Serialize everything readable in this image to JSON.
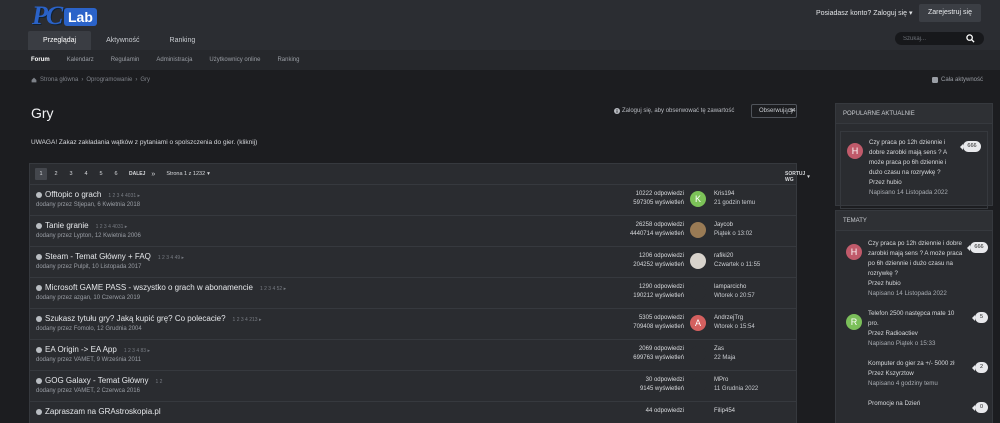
{
  "logo": {
    "pc": "PC",
    "lab": "Lab"
  },
  "header": {
    "account_link": "Posiadasz konto? Zaloguj się",
    "register_label": "Zarejestruj się",
    "tabs": [
      {
        "label": "Przeglądaj",
        "active": true
      },
      {
        "label": "Aktywność",
        "active": false
      },
      {
        "label": "Ranking",
        "active": false
      }
    ],
    "search_placeholder": "Szukaj..."
  },
  "subnav": [
    {
      "label": "Forum",
      "active": true
    },
    {
      "label": "Kalendarz"
    },
    {
      "label": "Regulamin"
    },
    {
      "label": "Administracja"
    },
    {
      "label": "Użytkownicy online"
    },
    {
      "label": "Ranking"
    }
  ],
  "breadcrumb": [
    "Strona główna",
    "Oprogramowanie",
    "Gry"
  ],
  "all_activity": "Cała aktywność",
  "page_title": "Gry",
  "login_follow": "Zaloguj się, aby obserwować tę zawartość",
  "follow": {
    "label": "Obserwujący",
    "count": "94"
  },
  "notice": "UWAGA! Zakaz zakładania wątków z pytaniami o spolszczenia do gier. (kliknij)",
  "pager": {
    "pages": [
      "1",
      "2",
      "3",
      "4",
      "5",
      "6"
    ],
    "next_label": "DALEJ",
    "last_glyph": "»",
    "page_of": "Strona 1 z 1232",
    "sort_label": "SORTUJ WG"
  },
  "topics": [
    {
      "title": "Offtopic o grach",
      "mini_pages": "1 2 3 4 4031 ▸",
      "byline": "dodany przez Stjepan, 6 Kwietnia 2018",
      "replies": "10222 odpowiedzi",
      "views": "597305 wyświetleń",
      "avatar_letter": "K",
      "avatar_color": "#7cc258",
      "last_user": "Kris194",
      "last_time": "21 godzin temu"
    },
    {
      "title": "Tanie granie",
      "mini_pages": "1 2 3 4 4031 ▸",
      "byline": "dodany przez Lypton, 12 Kwietnia 2006",
      "replies": "26258 odpowiedzi",
      "views": "4440714 wyświetleń",
      "avatar_letter": "",
      "avatar_color": "#9a7b55",
      "last_user": "Jaycob",
      "last_time": "Piątek o 13:02"
    },
    {
      "title": "Steam - Temat Główny + FAQ",
      "mini_pages": "1 2 3 4 49 ▸",
      "byline": "dodany przez Pulpit, 10 Listopada 2017",
      "replies": "1206 odpowiedzi",
      "views": "204252 wyświetleń",
      "avatar_letter": "",
      "avatar_color": "#d8d3cc",
      "last_user": "rafiki20",
      "last_time": "Czwartek o 11:55"
    },
    {
      "title": "Microsoft GAME PASS - wszystko o grach w abonamencie",
      "mini_pages": "1 2 3 4 52 ▸",
      "byline": "dodany przez azgan, 10 Czerwca 2019",
      "replies": "1290 odpowiedzi",
      "views": "190212 wyświetleń",
      "avatar_letter": "",
      "avatar_color": "#2a2c30",
      "last_user": "lamparcicho",
      "last_time": "Wtorek o 20:57"
    },
    {
      "title": "Szukasz tytułu gry? Jaką kupić grę? Co polecacie?",
      "mini_pages": "1 2 3 4 213 ▸",
      "byline": "dodany przez Fomolo, 12 Grudnia 2004",
      "replies": "5305 odpowiedzi",
      "views": "709408 wyświetleń",
      "avatar_letter": "A",
      "avatar_color": "#d4605f",
      "last_user": "AndrzejTrg",
      "last_time": "Wtorek o 15:54"
    },
    {
      "title": "EA Origin -> EA App",
      "mini_pages": "1 2 3 4 83 ▸",
      "byline": "dodany przez VAMET, 9 Września 2011",
      "replies": "2069 odpowiedzi",
      "views": "699763 wyświetleń",
      "avatar_letter": "",
      "avatar_color": "#2a2c30",
      "last_user": "Zas",
      "last_time": "22 Maja"
    },
    {
      "title": "GOG Galaxy - Temat Główny",
      "mini_pages": "1 2",
      "byline": "dodany przez VAMET, 2 Czerwca 2016",
      "replies": "30 odpowiedzi",
      "views": "9145 wyświetleń",
      "avatar_letter": "",
      "avatar_color": "#2a2c30",
      "last_user": "MPro",
      "last_time": "11 Grudnia 2022"
    },
    {
      "title": "Zapraszam na GRAstroskopia.pl",
      "mini_pages": "",
      "byline": "",
      "replies": "44 odpowiedzi",
      "views": "",
      "avatar_letter": "",
      "avatar_color": "#2a2c30",
      "last_user": "Filip454",
      "last_time": ""
    }
  ],
  "sidebar": {
    "popular_title": "POPULARNE AKTUALNIE",
    "popular": [
      {
        "avatar_letter": "H",
        "avatar_color": "#c05a6a",
        "title": "Czy praca po 12h dziennie i dobre zarobki mają sens ? A może praca po 6h dziennie i dużo czasu na rozrywkę ?",
        "by": "Przez hubio",
        "date": "Napisano 14 Listopada 2022",
        "count": "666"
      }
    ],
    "topics_title": "TEMATY",
    "topics": [
      {
        "avatar_letter": "H",
        "avatar_color": "#c05a6a",
        "title": "Czy praca po 12h dziennie i dobre zarobki mają sens ? A może praca po 6h dziennie i dużo czasu na rozrywkę ?",
        "by": "Przez hubio",
        "date": "Napisano 14 Listopada 2022",
        "count": "666"
      },
      {
        "avatar_letter": "R",
        "avatar_color": "#7bbf5a",
        "title": "Telefon 2500 następca mate 10 pro.",
        "by": "Przez Radioactiev",
        "date": "Napisano Piątek o 15:33",
        "count": "5"
      },
      {
        "avatar_letter": "",
        "avatar_color": "#2a2c30",
        "title": "Komputer do gier za +/- 5000 zł",
        "by": "Przez Kszyrztow",
        "date": "Napisano 4 godziny temu",
        "count": "2"
      },
      {
        "avatar_letter": "",
        "avatar_color": "#2a2c30",
        "title": "Promocje na Dzień",
        "by": "",
        "date": "",
        "count": "0"
      }
    ]
  }
}
